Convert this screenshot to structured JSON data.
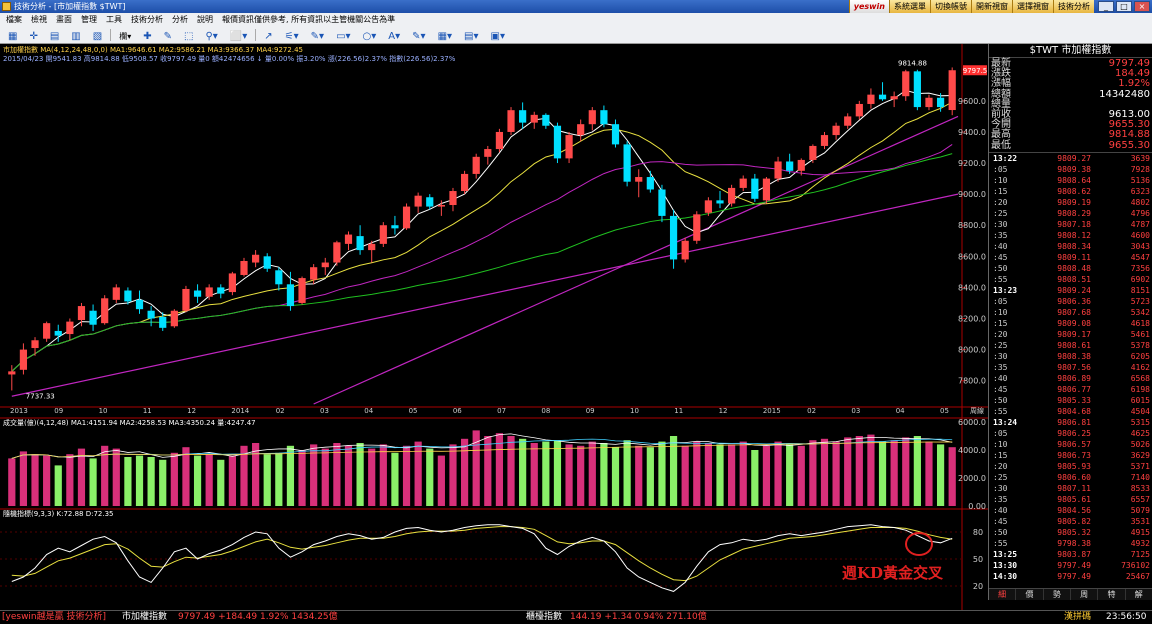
{
  "window": {
    "title": "技術分析 - [市加權指數 $TWT]"
  },
  "top_buttons": [
    "yeswin",
    "系統選單",
    "切換帳號",
    "開新視窗",
    "選擇視窗",
    "技術分析"
  ],
  "menu": [
    "檔案",
    "檢視",
    "畫面",
    "管理",
    "工具",
    "技術分析",
    "分析",
    "說明",
    "報價資訊僅供參考, 所有資訊以主管機關公告為準"
  ],
  "toolbar": [
    "▦",
    "✛",
    "▤",
    "▥",
    "▧",
    "欄▾",
    "✚",
    "✎",
    "⬚",
    "⚲▾",
    "⬜▾",
    "↗",
    "⚟▾",
    "✎▾",
    "▭▾",
    "○▾",
    "A▾",
    "✎▾",
    "▦▾",
    "▤▾",
    "▣▾"
  ],
  "chart_header": {
    "line1": "市加權指數 MA(4,12,24,48,0,0) MA1:9646.61 MA2:9586.21 MA3:9366.37 MA4:9272.45",
    "line2": "2015/04/23 開9541.83 高9814.88 低9508.57 收9797.49 量0 額42474656 ↓ 量0.00% 振3.20% 漲(226.56)2.37% 指數(226.56)2.37%",
    "high_label": "9814.88",
    "low_label": "7737.33",
    "last_label": "9797.5"
  },
  "price_axis": [
    "9600.0",
    "9400.0",
    "9200.0",
    "9000.0",
    "8800.0",
    "8600.0",
    "8400.0",
    "8200.0",
    "8000.0",
    "7800.0"
  ],
  "time_axis": [
    "2013",
    "09",
    "10",
    "11",
    "12",
    "2014",
    "02",
    "03",
    "04",
    "05",
    "06",
    "07",
    "08",
    "09",
    "10",
    "11",
    "12",
    "2015",
    "02",
    "03",
    "04",
    "05"
  ],
  "time_axis_unit": "周線",
  "volume_header": "成交量(億)(4,12,48) MA1:4151.94 MA2:4258.53 MA3:4350.24 量:4247.47",
  "volume_axis": [
    "6000.0",
    "4000.0",
    "2000.0",
    "0.00"
  ],
  "kd_header": "隨機指標(9,3,3) K:72.88 D:72.35",
  "kd_axis": [
    "80",
    "50",
    "20"
  ],
  "annotation": "週KD黃金交叉",
  "quote_panel": {
    "title": "$TWT 市加權指數",
    "summary": [
      {
        "label": "最新",
        "value": "9797.49",
        "color": "#ff4040"
      },
      {
        "label": "漲跌",
        "value": "184.49",
        "color": "#ff4040"
      },
      {
        "label": "漲幅",
        "value": "1.92%",
        "color": "#ff4040"
      },
      {
        "label": "總額",
        "value": "14342480",
        "color": "#ffffff"
      },
      {
        "label": "總量",
        "value": "",
        "color": "#ffffff"
      },
      {
        "label": "前收",
        "value": "9613.00",
        "color": "#ffffff"
      },
      {
        "label": "今開",
        "value": "9655.30",
        "color": "#ff4040"
      },
      {
        "label": "最高",
        "value": "9814.88",
        "color": "#ff4040"
      },
      {
        "label": "最低",
        "value": "9655.30",
        "color": "#ff4040"
      }
    ],
    "ticks": [
      [
        "13:22",
        "9809.27",
        "3639"
      ],
      [
        ":05",
        "9809.38",
        "7928"
      ],
      [
        ":10",
        "9808.64",
        "5136"
      ],
      [
        ":15",
        "9808.62",
        "6323"
      ],
      [
        ":20",
        "9809.19",
        "4802"
      ],
      [
        ":25",
        "9808.29",
        "4796"
      ],
      [
        ":30",
        "9807.18",
        "4787"
      ],
      [
        ":35",
        "9808.12",
        "4600"
      ],
      [
        ":40",
        "9808.34",
        "3043"
      ],
      [
        ":45",
        "9809.11",
        "4547"
      ],
      [
        ":50",
        "9808.48",
        "7356"
      ],
      [
        ":55",
        "9808.51",
        "6902"
      ],
      [
        "13:23",
        "9809.24",
        "8151"
      ],
      [
        ":05",
        "9806.36",
        "5723"
      ],
      [
        ":10",
        "9807.68",
        "5342"
      ],
      [
        ":15",
        "9809.08",
        "4618"
      ],
      [
        ":20",
        "9809.17",
        "5461"
      ],
      [
        ":25",
        "9808.61",
        "5378"
      ],
      [
        ":30",
        "9808.38",
        "6205"
      ],
      [
        ":35",
        "9807.56",
        "4162"
      ],
      [
        ":40",
        "9806.89",
        "6568"
      ],
      [
        ":45",
        "9806.77",
        "6198"
      ],
      [
        ":50",
        "9805.33",
        "6015"
      ],
      [
        ":55",
        "9804.68",
        "4504"
      ],
      [
        "13:24",
        "9806.81",
        "5315"
      ],
      [
        ":05",
        "9806.25",
        "4625"
      ],
      [
        ":10",
        "9806.57",
        "5026"
      ],
      [
        ":15",
        "9806.73",
        "3629"
      ],
      [
        ":20",
        "9805.93",
        "5371"
      ],
      [
        ":25",
        "9806.60",
        "7140"
      ],
      [
        ":30",
        "9807.11",
        "8533"
      ],
      [
        ":35",
        "9805.61",
        "6557"
      ],
      [
        ":40",
        "9804.56",
        "5079"
      ],
      [
        ":45",
        "9805.82",
        "3531"
      ],
      [
        ":50",
        "9805.32",
        "4915"
      ],
      [
        ":55",
        "9798.38",
        "4932"
      ],
      [
        "13:25",
        "9803.87",
        "7125"
      ],
      [
        "13:30",
        "9797.49",
        "736102"
      ],
      [
        "14:30",
        "9797.49",
        "25467"
      ]
    ],
    "tabs": [
      "細",
      "價",
      "勢",
      "周",
      "特",
      "解"
    ]
  },
  "statusbar": {
    "brand": "[yeswin越是贏 技術分析]",
    "index1_name": "市加權指數",
    "index1_value": "9797.49 +184.49 1.92% 1434.25億",
    "index2_name": "櫃檯指數",
    "index2_value": "144.19 +1.34 0.94% 271.10億",
    "status": "漢拼碼",
    "clock": "23:56:50"
  },
  "chart_data": {
    "type": "candlestick",
    "title": "市加權指數",
    "period": "weekly",
    "price_range": [
      7650,
      9850
    ],
    "candles": [
      [
        7840,
        7900,
        7737,
        7860
      ],
      [
        7870,
        8040,
        7840,
        8000
      ],
      [
        8010,
        8080,
        7960,
        8060
      ],
      [
        8070,
        8180,
        8050,
        8170
      ],
      [
        8120,
        8160,
        8050,
        8090
      ],
      [
        8100,
        8200,
        8060,
        8180
      ],
      [
        8190,
        8300,
        8150,
        8280
      ],
      [
        8250,
        8290,
        8120,
        8160
      ],
      [
        8170,
        8350,
        8160,
        8330
      ],
      [
        8320,
        8420,
        8300,
        8400
      ],
      [
        8380,
        8400,
        8290,
        8310
      ],
      [
        8320,
        8380,
        8230,
        8260
      ],
      [
        8250,
        8280,
        8150,
        8200
      ],
      [
        8210,
        8240,
        8120,
        8140
      ],
      [
        8150,
        8260,
        8140,
        8250
      ],
      [
        8250,
        8410,
        8240,
        8390
      ],
      [
        8380,
        8420,
        8300,
        8340
      ],
      [
        8340,
        8420,
        8320,
        8400
      ],
      [
        8400,
        8420,
        8330,
        8360
      ],
      [
        8370,
        8500,
        8350,
        8490
      ],
      [
        8480,
        8590,
        8470,
        8570
      ],
      [
        8560,
        8640,
        8530,
        8610
      ],
      [
        8600,
        8620,
        8500,
        8520
      ],
      [
        8510,
        8530,
        8380,
        8420
      ],
      [
        8420,
        8500,
        8250,
        8280
      ],
      [
        8300,
        8470,
        8290,
        8460
      ],
      [
        8450,
        8550,
        8420,
        8530
      ],
      [
        8530,
        8590,
        8480,
        8560
      ],
      [
        8560,
        8700,
        8540,
        8690
      ],
      [
        8680,
        8760,
        8640,
        8740
      ],
      [
        8730,
        8800,
        8610,
        8640
      ],
      [
        8640,
        8700,
        8560,
        8680
      ],
      [
        8680,
        8820,
        8660,
        8800
      ],
      [
        8800,
        8860,
        8740,
        8780
      ],
      [
        8780,
        8940,
        8770,
        8920
      ],
      [
        8920,
        9010,
        8880,
        8990
      ],
      [
        8980,
        9000,
        8900,
        8920
      ],
      [
        8920,
        8960,
        8860,
        8930
      ],
      [
        8930,
        9040,
        8890,
        9020
      ],
      [
        9020,
        9150,
        9000,
        9130
      ],
      [
        9130,
        9260,
        9100,
        9240
      ],
      [
        9240,
        9310,
        9190,
        9290
      ],
      [
        9290,
        9420,
        9270,
        9400
      ],
      [
        9400,
        9560,
        9380,
        9540
      ],
      [
        9540,
        9590,
        9420,
        9460
      ],
      [
        9460,
        9530,
        9420,
        9510
      ],
      [
        9510,
        9520,
        9420,
        9440
      ],
      [
        9440,
        9460,
        9200,
        9230
      ],
      [
        9230,
        9400,
        9200,
        9380
      ],
      [
        9380,
        9480,
        9340,
        9450
      ],
      [
        9450,
        9560,
        9410,
        9540
      ],
      [
        9540,
        9570,
        9430,
        9450
      ],
      [
        9450,
        9480,
        9300,
        9320
      ],
      [
        9320,
        9340,
        9050,
        9080
      ],
      [
        9080,
        9160,
        8980,
        9110
      ],
      [
        9110,
        9150,
        9010,
        9030
      ],
      [
        9030,
        9060,
        8820,
        8860
      ],
      [
        8860,
        8900,
        8520,
        8580
      ],
      [
        8580,
        8720,
        8560,
        8700
      ],
      [
        8700,
        8890,
        8680,
        8870
      ],
      [
        8880,
        8980,
        8860,
        8960
      ],
      [
        8960,
        9020,
        8910,
        8940
      ],
      [
        8940,
        9060,
        8920,
        9040
      ],
      [
        9040,
        9120,
        9020,
        9100
      ],
      [
        9100,
        9130,
        8950,
        8970
      ],
      [
        8960,
        9110,
        8940,
        9100
      ],
      [
        9100,
        9240,
        9080,
        9210
      ],
      [
        9210,
        9260,
        9130,
        9150
      ],
      [
        9150,
        9230,
        9120,
        9220
      ],
      [
        9220,
        9320,
        9200,
        9310
      ],
      [
        9310,
        9400,
        9290,
        9380
      ],
      [
        9380,
        9460,
        9350,
        9440
      ],
      [
        9440,
        9520,
        9420,
        9500
      ],
      [
        9500,
        9600,
        9480,
        9580
      ],
      [
        9580,
        9680,
        9550,
        9640
      ],
      [
        9640,
        9720,
        9600,
        9610
      ],
      [
        9610,
        9660,
        9560,
        9630
      ],
      [
        9630,
        9800,
        9600,
        9790
      ],
      [
        9790,
        9800,
        9540,
        9560
      ],
      [
        9560,
        9640,
        9540,
        9620
      ],
      [
        9620,
        9650,
        9530,
        9560
      ],
      [
        9541,
        9815,
        9508,
        9797
      ]
    ],
    "volume": [
      3400,
      3900,
      3700,
      3600,
      2900,
      3700,
      4100,
      3400,
      4300,
      4100,
      3500,
      3600,
      3500,
      3300,
      3800,
      4200,
      3600,
      3700,
      3300,
      3600,
      4300,
      4500,
      3700,
      3800,
      4300,
      4000,
      4400,
      4100,
      4500,
      4300,
      4500,
      4100,
      4400,
      3800,
      4300,
      4600,
      4100,
      3600,
      4400,
      4800,
      5400,
      5000,
      5200,
      5000,
      4800,
      4500,
      4600,
      4700,
      4400,
      4300,
      4600,
      4500,
      4200,
      4700,
      4300,
      4200,
      4600,
      5000,
      4300,
      4600,
      4500,
      4400,
      4400,
      4600,
      4000,
      4300,
      4600,
      4400,
      4300,
      4700,
      4800,
      4600,
      4900,
      5000,
      5100,
      4600,
      4700,
      4900,
      5000,
      4600,
      4400,
      4200
    ],
    "kd_k": [
      25,
      30,
      40,
      55,
      62,
      58,
      65,
      72,
      75,
      68,
      48,
      30,
      24,
      40,
      58,
      62,
      50,
      56,
      60,
      66,
      74,
      80,
      78,
      62,
      52,
      58,
      66,
      70,
      75,
      78,
      76,
      72,
      74,
      80,
      84,
      85,
      82,
      80,
      82,
      85,
      87,
      88,
      88,
      86,
      84,
      78,
      62,
      55,
      64,
      70,
      74,
      70,
      58,
      40,
      30,
      24,
      18,
      14,
      24,
      42,
      58,
      66,
      68,
      72,
      70,
      72,
      76,
      78,
      76,
      78,
      80,
      83,
      86,
      87,
      88,
      86,
      85,
      82,
      76,
      70,
      68,
      73
    ],
    "kd_d": [
      32,
      31,
      34,
      41,
      48,
      51,
      56,
      61,
      66,
      67,
      61,
      51,
      42,
      41,
      47,
      52,
      51,
      53,
      55,
      59,
      64,
      69,
      72,
      68,
      63,
      61,
      63,
      65,
      68,
      71,
      73,
      73,
      73,
      75,
      78,
      80,
      81,
      81,
      81,
      82,
      84,
      85,
      86,
      86,
      85,
      83,
      76,
      69,
      67,
      68,
      70,
      70,
      66,
      57,
      48,
      40,
      33,
      27,
      26,
      31,
      40,
      49,
      55,
      61,
      64,
      67,
      70,
      73,
      74,
      75,
      77,
      79,
      81,
      83,
      85,
      85,
      85,
      84,
      81,
      77,
      74,
      72
    ]
  }
}
